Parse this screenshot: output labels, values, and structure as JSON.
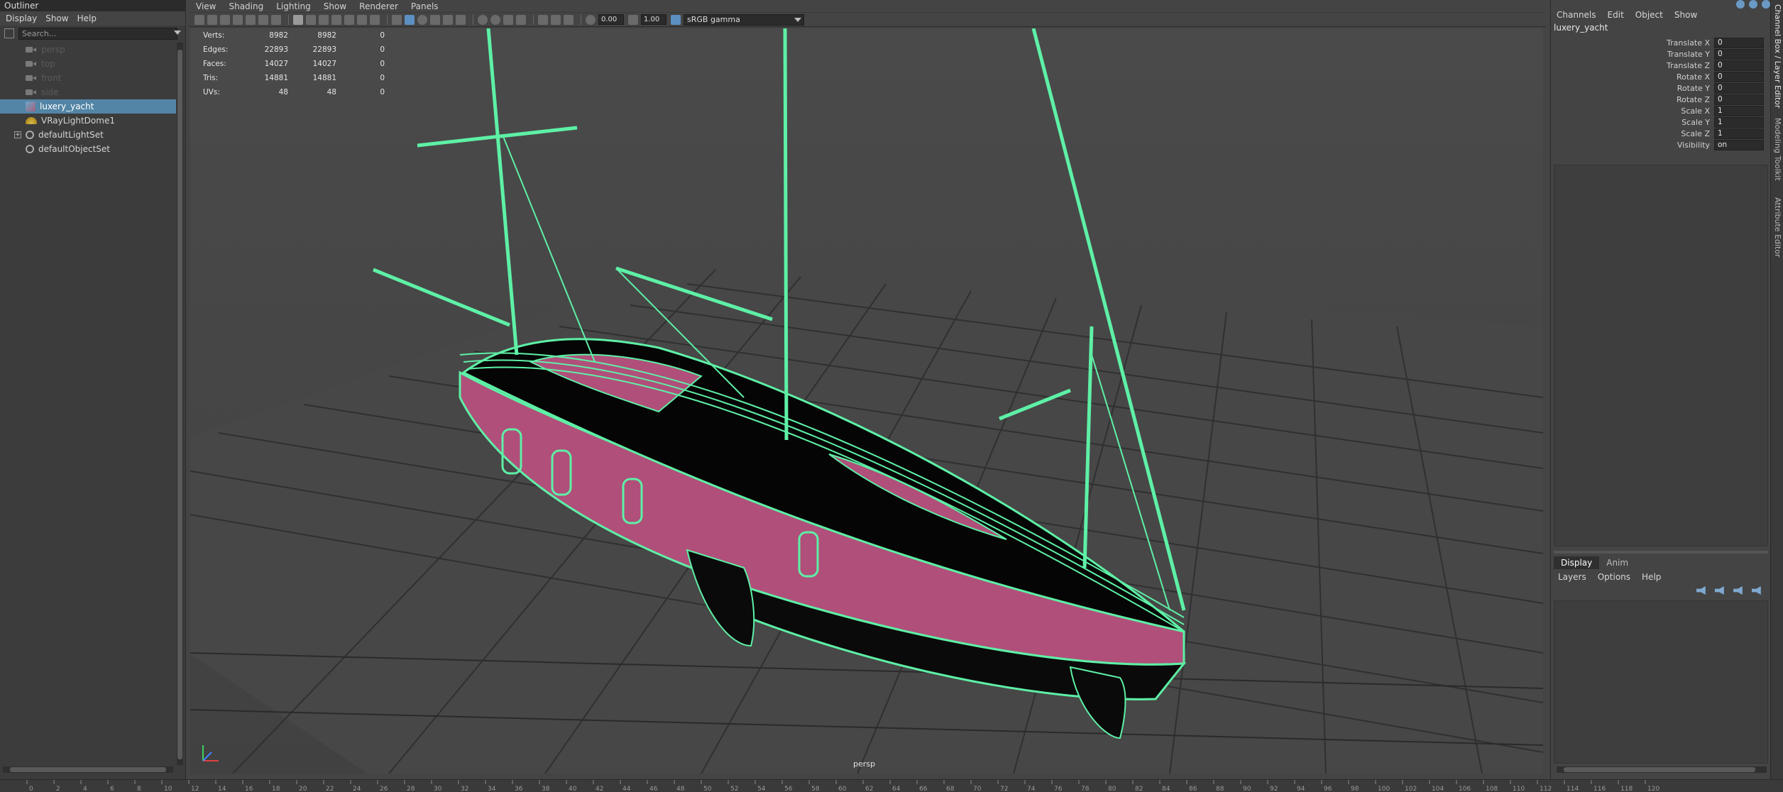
{
  "outliner": {
    "title": "Outliner",
    "menu": [
      "Display",
      "Show",
      "Help"
    ],
    "search_placeholder": "Search...",
    "items": [
      {
        "label": "persp",
        "icon": "camera-icon",
        "dim": true
      },
      {
        "label": "top",
        "icon": "camera-icon",
        "dim": true
      },
      {
        "label": "front",
        "icon": "camera-icon",
        "dim": true
      },
      {
        "label": "side",
        "icon": "camera-icon",
        "dim": true
      },
      {
        "label": "luxery_yacht",
        "icon": "mesh-icon",
        "selected": true
      },
      {
        "label": "VRayLightDome1",
        "icon": "light-dome-icon"
      },
      {
        "label": "defaultLightSet",
        "icon": "set-icon",
        "expandable": true,
        "expand_symbol": "+"
      },
      {
        "label": "defaultObjectSet",
        "icon": "set-icon"
      }
    ]
  },
  "viewport": {
    "menu": [
      "View",
      "Shading",
      "Lighting",
      "Show",
      "Renderer",
      "Panels"
    ],
    "exposure": "0.00",
    "gamma": "1.00",
    "color_space": "sRGB gamma",
    "camera_label": "persp",
    "stats": [
      {
        "label": "Verts:",
        "a": "8982",
        "b": "8982",
        "c": "0"
      },
      {
        "label": "Edges:",
        "a": "22893",
        "b": "22893",
        "c": "0"
      },
      {
        "label": "Faces:",
        "a": "14027",
        "b": "14027",
        "c": "0"
      },
      {
        "label": "Tris:",
        "a": "14881",
        "b": "14881",
        "c": "0"
      },
      {
        "label": "UVs:",
        "a": "48",
        "b": "48",
        "c": "0"
      }
    ],
    "colors": {
      "wire": "#5ef0a6",
      "hull": "#b04f7a",
      "deck": "#050505",
      "grid": "#2e2e2e"
    }
  },
  "timeline": {
    "ticks": [
      "0",
      "2",
      "4",
      "6",
      "8",
      "10",
      "12",
      "14",
      "16",
      "18",
      "20",
      "22",
      "24",
      "26",
      "28",
      "30",
      "32",
      "34",
      "36",
      "38",
      "40",
      "42",
      "44",
      "46",
      "48",
      "50",
      "52",
      "54",
      "56",
      "58",
      "60",
      "62",
      "64",
      "66",
      "68",
      "70",
      "72",
      "74",
      "76",
      "78",
      "80",
      "82",
      "84",
      "86",
      "88",
      "90",
      "92",
      "94",
      "96",
      "98",
      "100",
      "102",
      "104",
      "106",
      "108",
      "110",
      "112",
      "114",
      "116",
      "118",
      "120"
    ]
  },
  "channel_box": {
    "menu": [
      "Channels",
      "Edit",
      "Object",
      "Show"
    ],
    "object_name": "luxery_yacht",
    "attributes": [
      {
        "label": "Translate X",
        "value": "0"
      },
      {
        "label": "Translate Y",
        "value": "0"
      },
      {
        "label": "Translate Z",
        "value": "0"
      },
      {
        "label": "Rotate X",
        "value": "0"
      },
      {
        "label": "Rotate Y",
        "value": "0"
      },
      {
        "label": "Rotate Z",
        "value": "0"
      },
      {
        "label": "Scale X",
        "value": "1"
      },
      {
        "label": "Scale Y",
        "value": "1"
      },
      {
        "label": "Scale Z",
        "value": "1"
      },
      {
        "label": "Visibility",
        "value": "on"
      }
    ],
    "layer_tabs": [
      "Display",
      "Anim"
    ],
    "layer_menu": [
      "Layers",
      "Options",
      "Help"
    ]
  },
  "side_tabs": [
    "Channel Box / Layer Editor",
    "Modeling Toolkit",
    "Attribute Editor"
  ]
}
